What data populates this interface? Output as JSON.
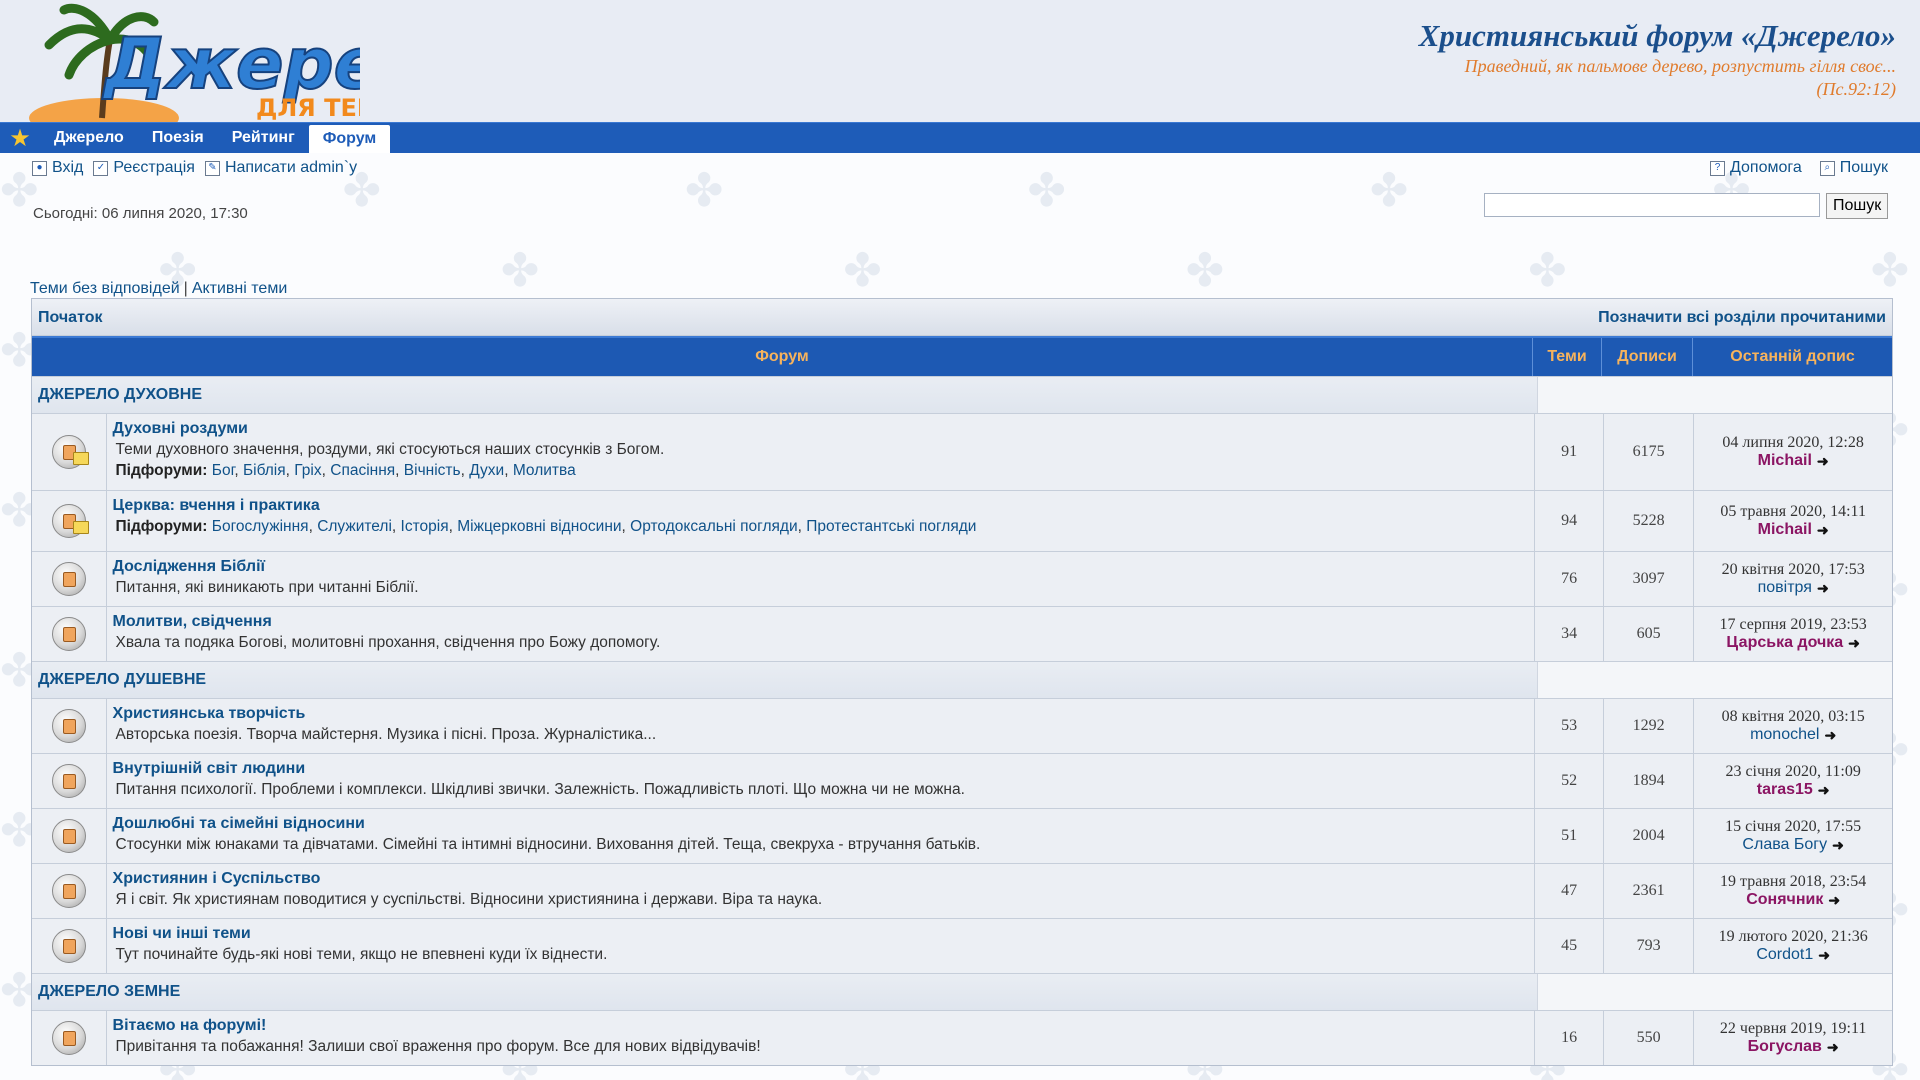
{
  "header": {
    "logo_alt": "Джерело для тебе",
    "title": "Християнський форум «Джерело»",
    "subtitle": "Праведний, як пальмове дерево, розпустить гілля своє...",
    "verse": "(Пс.92:12)"
  },
  "nav": {
    "items": [
      "Джерело",
      "Поезія",
      "Рейтинг",
      "Форум"
    ],
    "active": "Форум"
  },
  "toolbar": {
    "login": "Вхід",
    "register": "Реєстрація",
    "write_admin": "Написати admin`у",
    "help": "Допомога",
    "search": "Пошук"
  },
  "search": {
    "today": "Сьогодні: 06 липня 2020, 17:30",
    "button": "Пошук",
    "value": ""
  },
  "quick": {
    "unanswered": "Теми без відповідей",
    "separator": "|",
    "active": "Активні теми"
  },
  "crumbs": {
    "home": "Початок",
    "mark_read": "Позначити всі розділи прочитаними"
  },
  "columns": {
    "forum": "Форум",
    "topics": "Теми",
    "posts": "Дописи",
    "last": "Останній допис"
  },
  "categories": [
    {
      "name": "ДЖЕРЕЛО ДУХОВНЕ",
      "forums": [
        {
          "title": "Духовні роздуми",
          "desc": "Теми духовного значення, роздуми, які стосуються наших стосунків з Богом.",
          "subs_label": "Підфоруми:",
          "subs": [
            "Бог",
            "Біблія",
            "Гріх",
            "Спасіння",
            "Вічність",
            "Духи",
            "Молитва"
          ],
          "topics": "91",
          "posts": "6175",
          "last_date": "04 липня 2020, 12:28",
          "last_user": "Michail",
          "user_color": "#8b1563",
          "user_bold": true,
          "new": true
        },
        {
          "title": "Церква: вчення і практика",
          "desc": "",
          "subs_label": "Підфоруми:",
          "subs": [
            "Богослужіння",
            "Служителі",
            "Історія",
            "Міжцерковні відносини",
            "Ортодоксальні погляди",
            "Протестантські погляди"
          ],
          "topics": "94",
          "posts": "5228",
          "last_date": "05 травня 2020, 14:11",
          "last_user": "Michail",
          "user_color": "#8b1563",
          "user_bold": true,
          "new": true
        },
        {
          "title": "Дослідження Біблії",
          "desc": "Питання, які виникають при читанні Біблії.",
          "subs_label": "",
          "subs": [],
          "topics": "76",
          "posts": "3097",
          "last_date": "20 квітня 2020, 17:53",
          "last_user": "повітря",
          "user_color": "#105289",
          "user_bold": false,
          "new": false
        },
        {
          "title": "Молитви, свідчення",
          "desc": "Хвала та подяка Богові, молитовні прохання, свідчення про Божу допомогу.",
          "subs_label": "",
          "subs": [],
          "topics": "34",
          "posts": "605",
          "last_date": "17 серпня 2019, 23:53",
          "last_user": "Царська дочка",
          "user_color": "#8b1563",
          "user_bold": true,
          "new": false
        }
      ]
    },
    {
      "name": "ДЖЕРЕЛО ДУШЕВНЕ",
      "forums": [
        {
          "title": "Християнська творчість",
          "desc": "Авторська поезія. Творча майстерня. Музика і пісні. Проза. Журналістика...",
          "subs_label": "",
          "subs": [],
          "topics": "53",
          "posts": "1292",
          "last_date": "08 квітня 2020, 03:15",
          "last_user": "monochel",
          "user_color": "#105289",
          "user_bold": false,
          "new": false
        },
        {
          "title": "Внутрішній світ людини",
          "desc": "Питання психології. Проблеми і комплекси. Шкідливі звички. Залежність. Пожадливість плоті. Що можна чи не можна.",
          "subs_label": "",
          "subs": [],
          "topics": "52",
          "posts": "1894",
          "last_date": "23 січня 2020, 11:09",
          "last_user": "taras15",
          "user_color": "#8b1563",
          "user_bold": true,
          "new": false
        },
        {
          "title": "Дошлюбні та сімейні відносини",
          "desc": "Стосунки між юнаками та дівчатами. Сімейні та інтимні відносини. Виховання дітей. Теща, свекруха - втручання батьків.",
          "subs_label": "",
          "subs": [],
          "topics": "51",
          "posts": "2004",
          "last_date": "15 січня 2020, 17:55",
          "last_user": "Слава Богу",
          "user_color": "#105289",
          "user_bold": false,
          "new": false
        },
        {
          "title": "Християнин і Суспільство",
          "desc": "Я і світ. Як християнам поводитися у суспільстві. Відносини християнина і держави. Віра та наука.",
          "subs_label": "",
          "subs": [],
          "topics": "47",
          "posts": "2361",
          "last_date": "19 травня 2018, 23:54",
          "last_user": "Сонячник",
          "user_color": "#8b1563",
          "user_bold": true,
          "new": false
        },
        {
          "title": "Нові чи інші теми",
          "desc": "Тут починайте будь-які нові теми, якщо не впевнені куди їх віднести.",
          "subs_label": "",
          "subs": [],
          "topics": "45",
          "posts": "793",
          "last_date": "19 лютого 2020, 21:36",
          "last_user": "Cordot1",
          "user_color": "#105289",
          "user_bold": false,
          "new": false
        }
      ]
    },
    {
      "name": "ДЖЕРЕЛО ЗЕМНЕ",
      "forums": [
        {
          "title": "Вітаємо на форумі!",
          "desc": "Привітання та побажання! Залиши свої враження про форум. Все для нових відвідувачів!",
          "subs_label": "",
          "subs": [],
          "topics": "16",
          "posts": "550",
          "last_date": "22 червня 2019, 19:11",
          "last_user": "Богуслав",
          "user_color": "#8b1563",
          "user_bold": true,
          "new": false
        }
      ]
    }
  ],
  "colors": {
    "nav_blue": "#1e5cb8",
    "link": "#105289",
    "accent_orange": "#e07b2c",
    "header_gold": "#f7b35c"
  }
}
